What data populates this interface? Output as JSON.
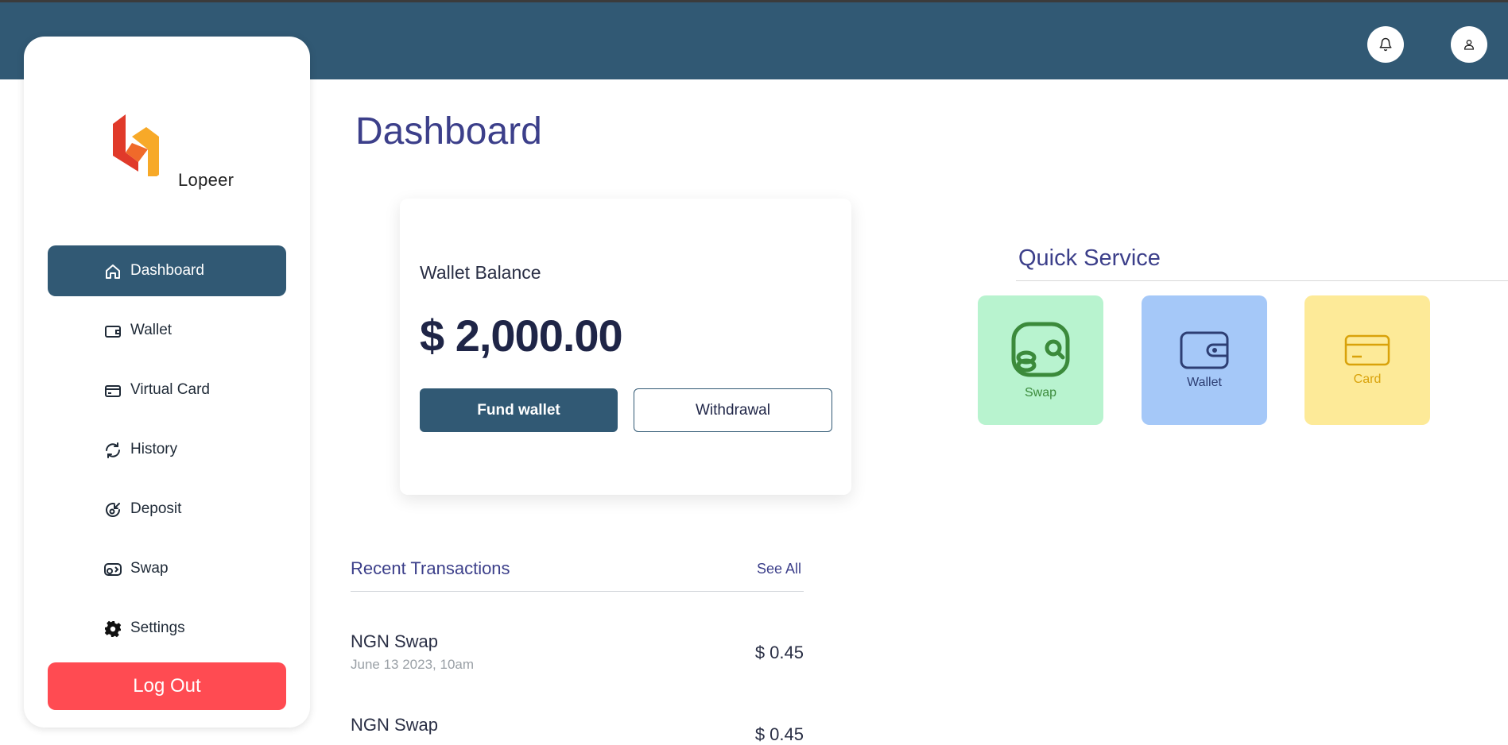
{
  "brand": {
    "name": "Lopeer"
  },
  "header": {
    "bell_icon": "bell-icon",
    "user_icon": "user-icon"
  },
  "sidebar": {
    "items": [
      {
        "label": "Dashboard",
        "icon": "home-icon",
        "active": true
      },
      {
        "label": "Wallet",
        "icon": "wallet-icon"
      },
      {
        "label": "Virtual Card",
        "icon": "credit-card-icon"
      },
      {
        "label": "History",
        "icon": "history-icon"
      },
      {
        "label": "Deposit",
        "icon": "deposit-icon"
      },
      {
        "label": "Swap",
        "icon": "swap-icon"
      },
      {
        "label": "Settings",
        "icon": "gear-icon"
      }
    ],
    "logout_label": "Log Out"
  },
  "main": {
    "title": "Dashboard",
    "wallet": {
      "label": "Wallet Balance",
      "amount": "$ 2,000.00",
      "fund_label": "Fund wallet",
      "withdraw_label": "Withdrawal"
    },
    "quick_service": {
      "title": "Quick Service",
      "tiles": [
        {
          "label": "Swap",
          "icon": "swap-coins-icon"
        },
        {
          "label": "Wallet",
          "icon": "wallet-icon"
        },
        {
          "label": "Card",
          "icon": "credit-card-icon"
        }
      ]
    },
    "recent": {
      "title": "Recent Transactions",
      "see_all": "See All",
      "transactions": [
        {
          "name": "NGN Swap",
          "date": "June 13 2023, 10am",
          "amount": "$ 0.45"
        },
        {
          "name": "NGN Swap",
          "date": "",
          "amount": "$ 0.45"
        }
      ]
    }
  },
  "colors": {
    "topbar": "#315974",
    "accent": "#3c3f8a",
    "logout": "#ff4b52"
  }
}
